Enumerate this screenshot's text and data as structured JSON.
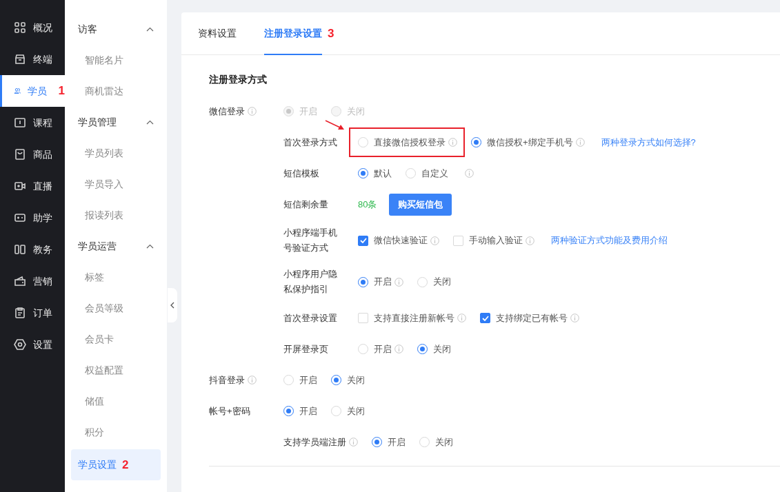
{
  "nav": [
    {
      "label": "概况",
      "selected": false
    },
    {
      "label": "终端",
      "selected": false
    },
    {
      "label": "学员",
      "selected": true,
      "badge": "1"
    },
    {
      "label": "课程",
      "selected": false
    },
    {
      "label": "商品",
      "selected": false
    },
    {
      "label": "直播",
      "selected": false
    },
    {
      "label": "助学",
      "selected": false
    },
    {
      "label": "教务",
      "selected": false
    },
    {
      "label": "营销",
      "selected": false
    },
    {
      "label": "订单",
      "selected": false
    },
    {
      "label": "设置",
      "selected": false
    }
  ],
  "subnav": [
    {
      "title": "访客",
      "expanded": true,
      "items": [
        {
          "label": "智能名片",
          "selected": false
        },
        {
          "label": "商机雷达",
          "selected": false
        }
      ]
    },
    {
      "title": "学员管理",
      "expanded": true,
      "items": [
        {
          "label": "学员列表",
          "selected": false
        },
        {
          "label": "学员导入",
          "selected": false
        },
        {
          "label": "报读列表",
          "selected": false
        }
      ]
    },
    {
      "title": "学员运营",
      "expanded": true,
      "items": [
        {
          "label": "标签",
          "selected": false
        },
        {
          "label": "会员等级",
          "selected": false
        },
        {
          "label": "会员卡",
          "selected": false
        },
        {
          "label": "权益配置",
          "selected": false
        },
        {
          "label": "储值",
          "selected": false
        },
        {
          "label": "积分",
          "selected": false
        }
      ]
    },
    {
      "items": [
        {
          "label": "学员设置",
          "selected": true,
          "badge": "2"
        }
      ]
    }
  ],
  "tabs": [
    {
      "label": "资料设置",
      "selected": false
    },
    {
      "label": "注册登录设置",
      "selected": true,
      "badge": "3"
    }
  ],
  "section_title": "注册登录方式",
  "settings": [
    {
      "kind": "radio",
      "label": "微信登录",
      "info": true,
      "options": [
        {
          "label": "开启",
          "selected": true,
          "disabled": true
        },
        {
          "label": "关闭",
          "selected": false,
          "disabled": true
        }
      ],
      "children": [
        {
          "kind": "radio",
          "label": "首次登录方式",
          "options": [
            {
              "label": "直接微信授权登录",
              "selected": false,
              "info": true,
              "highlighted": true
            },
            {
              "label": "微信授权+绑定手机号",
              "selected": true,
              "info": true,
              "highlighted": false
            }
          ],
          "link": "两种登录方式如何选择?"
        },
        {
          "kind": "radio",
          "label": "短信模板",
          "options": [
            {
              "label": "默认",
              "selected": true
            },
            {
              "label": "自定义",
              "selected": false
            }
          ],
          "trailing_info": true
        },
        {
          "kind": "sms",
          "label": "短信剩余量",
          "count": "80条",
          "button": "购买短信包"
        },
        {
          "kind": "checkbox",
          "label": "小程序端手机号验证方式",
          "options": [
            {
              "label": "微信快速验证",
              "checked": true,
              "info": true
            },
            {
              "label": "手动输入验证",
              "checked": false,
              "info": true
            }
          ],
          "link": "两种验证方式功能及费用介绍"
        },
        {
          "kind": "radio",
          "label": "小程序用户隐私保护指引",
          "options": [
            {
              "label": "开启",
              "selected": true,
              "info": true
            },
            {
              "label": "关闭",
              "selected": false
            }
          ]
        },
        {
          "kind": "checkbox",
          "label": "首次登录设置",
          "options": [
            {
              "label": "支持直接注册新帐号",
              "checked": false,
              "info": true
            },
            {
              "label": "支持绑定已有帐号",
              "checked": true,
              "info": true
            }
          ]
        },
        {
          "kind": "radio",
          "label": "开屏登录页",
          "options": [
            {
              "label": "开启",
              "selected": false,
              "info": true
            },
            {
              "label": "关闭",
              "selected": true
            }
          ]
        }
      ]
    },
    {
      "kind": "radio",
      "label": "抖音登录",
      "info": true,
      "options": [
        {
          "label": "开启",
          "selected": false
        },
        {
          "label": "关闭",
          "selected": true
        }
      ]
    },
    {
      "kind": "radio",
      "label": "帐号+密码",
      "options": [
        {
          "label": "开启",
          "selected": true
        },
        {
          "label": "关闭",
          "selected": false
        }
      ],
      "children": [
        {
          "kind": "radio",
          "label": "支持学员端注册",
          "info": true,
          "options": [
            {
              "label": "开启",
              "selected": true
            },
            {
              "label": "关闭",
              "selected": false
            }
          ]
        }
      ]
    }
  ]
}
